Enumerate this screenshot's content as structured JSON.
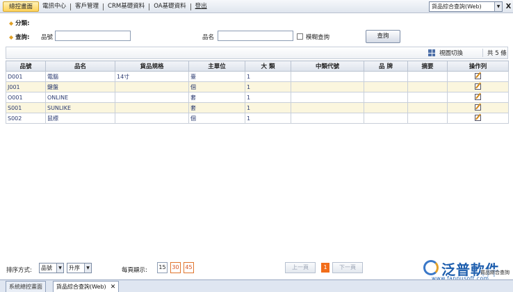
{
  "menu": {
    "items": [
      "總控畫面",
      "電訊中心",
      "客戶管理",
      "CRM基礎資料",
      "OA基礎資料",
      "登出"
    ],
    "module_selected": "貨品綜合查詢(Web)",
    "close": "X"
  },
  "filter": {
    "category_label": "分類:",
    "query_label": "查詢:",
    "part_no_label": "品號",
    "part_no_value": "",
    "part_name_label": "品名",
    "part_name_value": "",
    "fuzzy_label": "模糊查詢",
    "query_button": "查詢"
  },
  "toolbar": {
    "view_switch": "視圖切換",
    "total": "共 5 條"
  },
  "table": {
    "headers": [
      "品號",
      "品名",
      "貨品規格",
      "主單位",
      "大 類",
      "中類代號",
      "品 牌",
      "摘要",
      "操作列"
    ],
    "rows": [
      [
        "D001",
        "電腦",
        "14寸",
        "臺",
        "1",
        "",
        "",
        "",
        ""
      ],
      [
        "J001",
        "鍵盤",
        "",
        "個",
        "1",
        "",
        "",
        "",
        ""
      ],
      [
        "O001",
        "ONLINE",
        "",
        "套",
        "1",
        "",
        "",
        "",
        ""
      ],
      [
        "S001",
        "SUNLIKE",
        "",
        "套",
        "1",
        "",
        "",
        "",
        ""
      ],
      [
        "S002",
        "鼠標",
        "",
        "個",
        "1",
        "",
        "",
        "",
        ""
      ]
    ]
  },
  "bottom": {
    "sort_label": "排序方式:",
    "sort_field": "品號",
    "sort_order": "升序",
    "per_page_label": "每頁顯示:",
    "page_sizes": [
      "15",
      "30",
      "45"
    ],
    "prev": "上一頁",
    "current_page": "1",
    "next": "下一頁"
  },
  "logo": {
    "name": "泛普軟件",
    "sub": "貨品綜合查詢",
    "url": "www.fanpusoft.com"
  },
  "tabs": {
    "items": [
      "系統總控畫面",
      "貨品綜合查詢(Web)"
    ],
    "close": "✕"
  },
  "colors": {
    "accent": "#ffd35a",
    "row_alt": "#fbf6de",
    "page_active": "#f26d1a",
    "logo_blue": "#1f5fae"
  }
}
